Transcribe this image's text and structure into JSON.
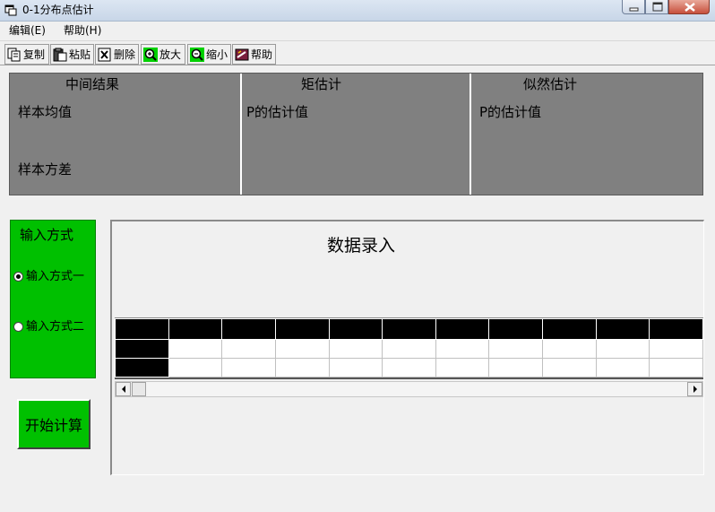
{
  "window": {
    "title": "0-1分布点估计"
  },
  "menu": {
    "edit": "编辑(E)",
    "help": "帮助(H)"
  },
  "toolbar": {
    "copy": "复制",
    "paste": "粘贴",
    "delete": "删除",
    "zoom_in": "放大",
    "zoom_out": "缩小",
    "help": "帮助"
  },
  "results": {
    "intermediate": {
      "heading": "中间结果",
      "sample_mean": "样本均值",
      "sample_variance": "样本方差"
    },
    "moment": {
      "heading": "矩估计",
      "estimate": "P的估计值"
    },
    "mle": {
      "heading": "似然估计",
      "estimate": "P的估计值"
    }
  },
  "input_mode": {
    "title": "输入方式",
    "options": [
      {
        "label": "输入方式一",
        "selected": true
      },
      {
        "label": "输入方式二",
        "selected": false
      }
    ]
  },
  "start_button": "开始计算",
  "data_entry": {
    "title": "数据录入"
  },
  "colors": {
    "green_panel": "#00c000",
    "results_gray": "#808080",
    "grid_header": "#000000"
  }
}
